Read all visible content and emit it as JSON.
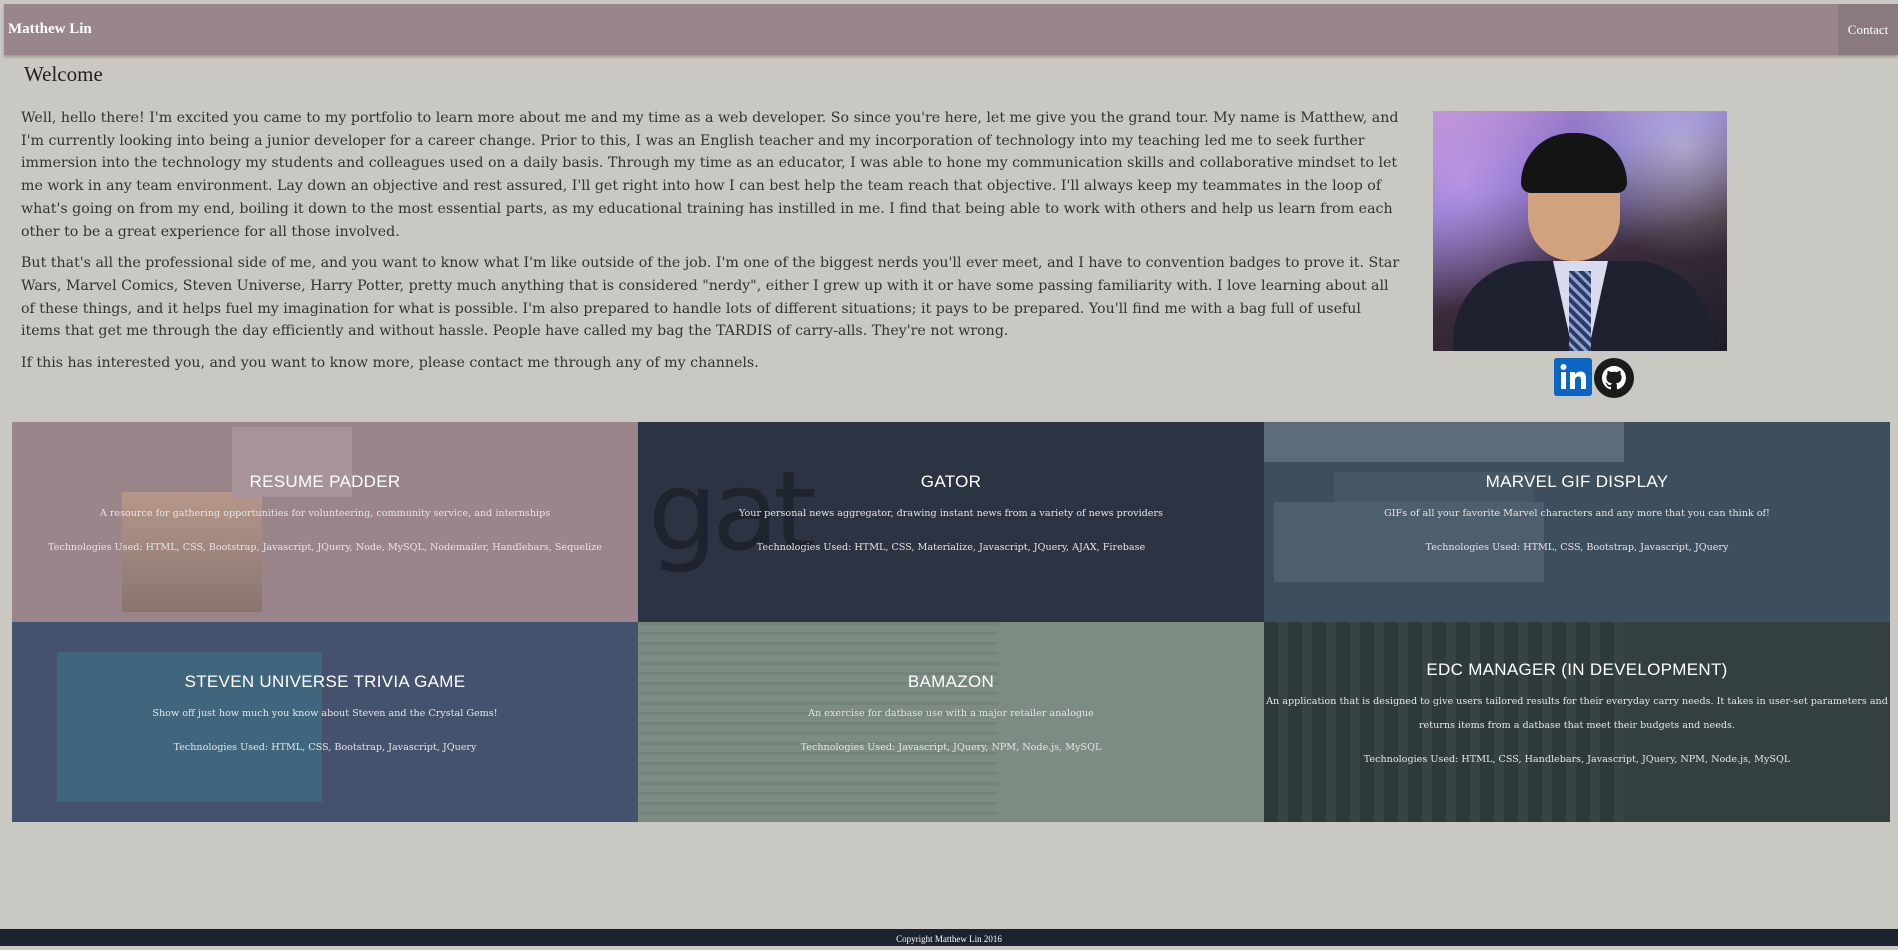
{
  "nav": {
    "brand": "Matthew Lin",
    "contact": "Contact"
  },
  "about": {
    "heading": "Welcome",
    "paragraphs": [
      "Well, hello there! I'm excited you came to my portfolio to learn more about me and my time as a web developer. So since you're here, let me give you the grand tour. My name is Matthew, and I'm currently looking into being a junior developer for a career change. Prior to this, I was an English teacher and my incorporation of technology into my teaching led me to seek further immersion into the technology my students and colleagues used on a daily basis. Through my time as an educator, I was able to hone my communication skills and collaborative mindset to let me work in any team environment. Lay down an objective and rest assured, I'll get right into how I can best help the team reach that objective. I'll always keep my teammates in the loop of what's going on from my end, boiling it down to the most essential parts, as my educational training has instilled in me. I find that being able to work with others and help us learn from each other to be a great experience for all those involved.",
      "But that's all the professional side of me, and you want to know what I'm like outside of the job. I'm one of the biggest nerds you'll ever meet, and I have to convention badges to prove it. Star Wars, Marvel Comics, Steven Universe, Harry Potter, pretty much anything that is considered \"nerdy\", either I grew up with it or have some passing familiarity with. I love learning about all of these things, and it helps fuel my imagination for what is possible. I'm also prepared to handle lots of different situations; it pays to be prepared. You'll find me with a bag full of useful items that get me through the day efficiently and without hassle. People have called my bag the TARDIS of carry-alls. They're not wrong.",
      "If this has interested you, and you want to know more, please contact me through any of my channels."
    ]
  },
  "projects": [
    {
      "title": "RESUME PADDER",
      "description": "A resource for gathering opportunities for volunteering, community service, and internships",
      "tech": "Technologies Used: HTML, CSS, Bootstrap, Javascript, JQuery, Node, MySQL, Nodemailer, Handlebars, Sequelize"
    },
    {
      "title": "GATOR",
      "description": "Your personal news aggregator, drawing instant news from a variety of news providers",
      "tech": "Technologies Used: HTML, CSS, Materialize, Javascript, JQuery, AJAX, Firebase"
    },
    {
      "title": "MARVEL GIF DISPLAY",
      "description": "GIFs of all your favorite Marvel characters and any more that you can think of!",
      "tech": "Technologies Used: HTML, CSS, Bootstrap, Javascript, JQuery"
    },
    {
      "title": "STEVEN UNIVERSE TRIVIA GAME",
      "description": "Show off just how much you know about Steven and the Crystal Gems!",
      "tech": "Technologies Used: HTML, CSS, Bootstrap, Javascript, JQuery"
    },
    {
      "title": "BAMAZON",
      "description": "An exercise for datbase use with a major retailer analogue",
      "tech": "Technologies Used: Javascript, JQuery, NPM, Node.js, MySQL"
    },
    {
      "title": "EDC MANAGER (IN DEVELOPMENT)",
      "description": "An application that is designed to give users tailored results for their everyday carry needs. It takes in user-set parameters and returns items from a datbase that meet their budgets and needs.",
      "tech": "Technologies Used: HTML, CSS, Handlebars, Javascript, JQuery, NPM, Node.js, MySQL"
    }
  ],
  "footer": {
    "copyright": "Copyright Matthew Lin 2016"
  },
  "colors": {
    "navbar": "#99868d",
    "background": "#cac8c2",
    "footer": "#1c232e"
  }
}
